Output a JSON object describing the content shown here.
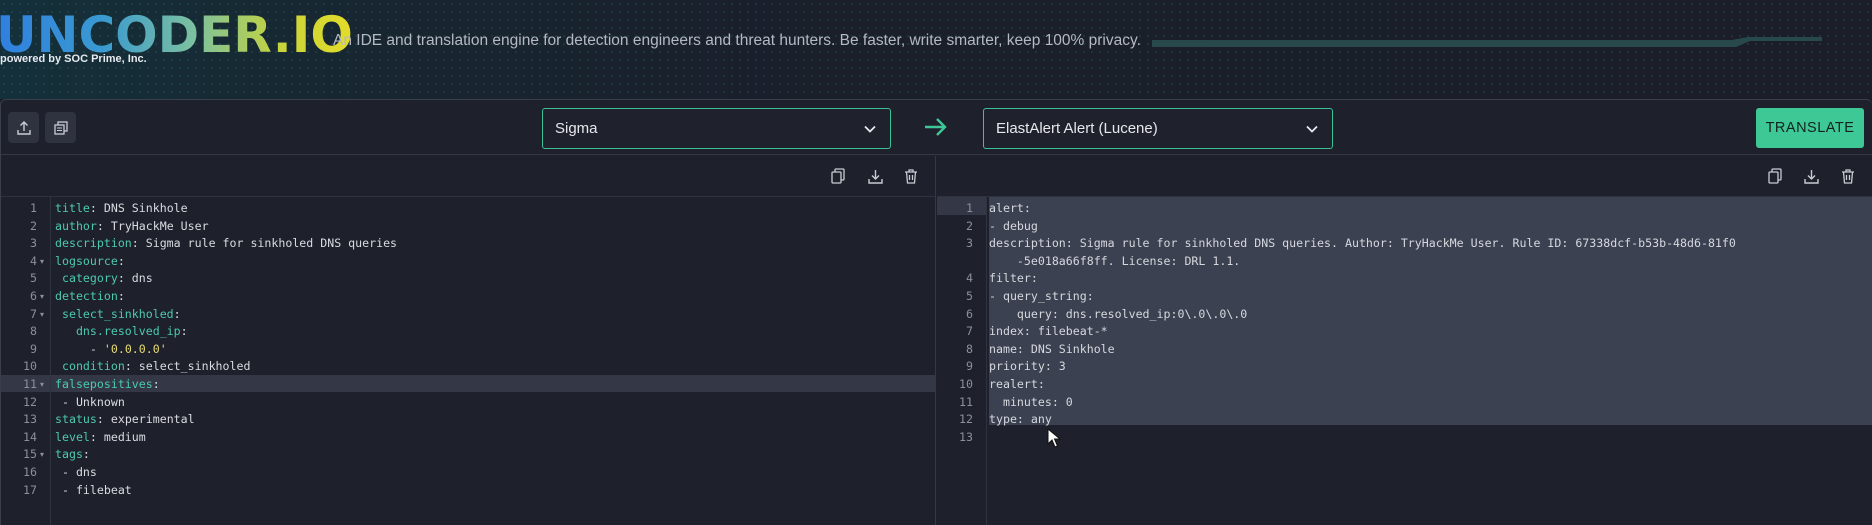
{
  "header": {
    "logo": "UNCODER.IO",
    "powered_by": "powered by SOC Prime, Inc.",
    "tagline": "An IDE and translation engine for detection engineers and threat hunters. Be faster, write smarter, keep 100% privacy."
  },
  "toolbar": {
    "upload_icon": "upload-icon",
    "copy_icon": "copy-stack-icon",
    "source_select": "Sigma",
    "target_select": "ElastAlert Alert (Lucene)",
    "translate_label": "TRANSLATE",
    "accent_color": "#3ec896"
  },
  "left_editor": {
    "icons": [
      "copy-icon",
      "download-icon",
      "trash-icon"
    ],
    "lines": [
      {
        "num": "1",
        "key": "title",
        "val": " DNS Sinkhole"
      },
      {
        "num": "2",
        "key": "author",
        "val": " TryHackMe User"
      },
      {
        "num": "3",
        "key": "description",
        "val": " Sigma rule for sinkholed DNS queries"
      },
      {
        "num": "4",
        "key": "logsource",
        "val": ""
      },
      {
        "num": "5",
        "key": " category",
        "val": " dns"
      },
      {
        "num": "6",
        "key": "detection",
        "val": ""
      },
      {
        "num": "7",
        "key": " select_sinkholed",
        "val": ""
      },
      {
        "num": "8",
        "key": "   dns.resolved_ip",
        "val": ""
      },
      {
        "num": "9",
        "key": "",
        "val": "     - ",
        "str": "'0.0.0.0'"
      },
      {
        "num": "10",
        "key": " condition",
        "val": " select_sinkholed"
      },
      {
        "num": "11",
        "key": "falsepositives",
        "val": ""
      },
      {
        "num": "12",
        "key": "",
        "val": " - Unknown"
      },
      {
        "num": "13",
        "key": "status",
        "val": " experimental"
      },
      {
        "num": "14",
        "key": "level",
        "val": " medium"
      },
      {
        "num": "15",
        "key": "tags",
        "val": ""
      },
      {
        "num": "16",
        "key": "",
        "val": " - dns"
      },
      {
        "num": "17",
        "key": "",
        "val": " - filebeat"
      }
    ]
  },
  "right_editor": {
    "icons": [
      "copy-icon",
      "download-icon",
      "trash-icon"
    ],
    "line_numbers": [
      "1",
      "2",
      "3",
      "",
      "4",
      "5",
      "6",
      "7",
      "8",
      "9",
      "10",
      "11",
      "12",
      "13"
    ],
    "lines": [
      "alert:",
      "- debug",
      "description: Sigma rule for sinkholed DNS queries. Author: TryHackMe User. Rule ID: 67338dcf-b53b-48d6-81f0",
      "    -5e018a66f8ff. License: DRL 1.1.",
      "filter:",
      "- query_string:",
      "    query: dns.resolved_ip:0\\.0\\.0\\.0",
      "index: filebeat-*",
      "name: DNS Sinkhole",
      "priority: 3",
      "realert:",
      "  minutes: 0",
      "type: any",
      ""
    ]
  }
}
